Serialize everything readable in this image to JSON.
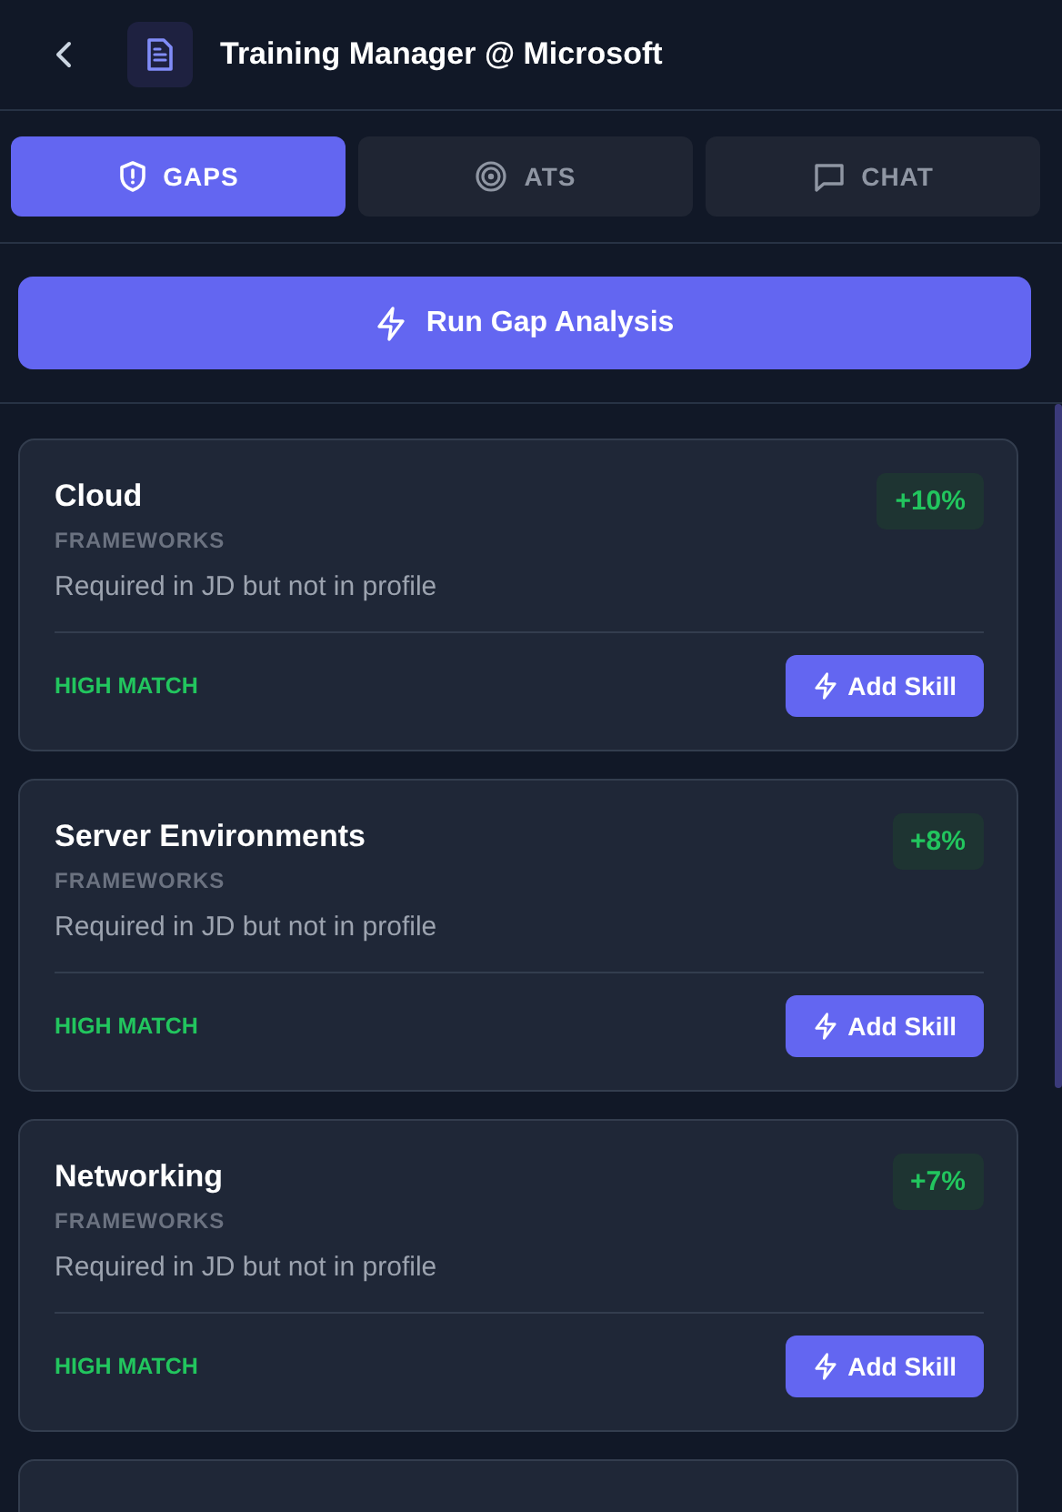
{
  "header": {
    "title": "Training Manager @ Microsoft"
  },
  "tabs": [
    {
      "label": "GAPS",
      "selected": true
    },
    {
      "label": "ATS",
      "selected": false
    },
    {
      "label": "CHAT",
      "selected": false
    }
  ],
  "run_button": {
    "label": "Run Gap Analysis"
  },
  "gaps": [
    {
      "name": "Cloud",
      "category": "FRAMEWORKS",
      "reason": "Required in JD but not in profile",
      "boost": "+10%",
      "match": {
        "kind": "high",
        "label": "HIGH MATCH"
      },
      "action": "Add Skill"
    },
    {
      "name": "Server Environments",
      "category": "FRAMEWORKS",
      "reason": "Required in JD but not in profile",
      "boost": "+8%",
      "match": {
        "kind": "high",
        "label": "HIGH MATCH"
      },
      "action": "Add Skill"
    },
    {
      "name": "Networking",
      "category": "FRAMEWORKS",
      "reason": "Required in JD but not in profile",
      "boost": "+7%",
      "match": {
        "kind": "high",
        "label": "HIGH MATCH"
      },
      "action": "Add Skill"
    }
  ]
}
